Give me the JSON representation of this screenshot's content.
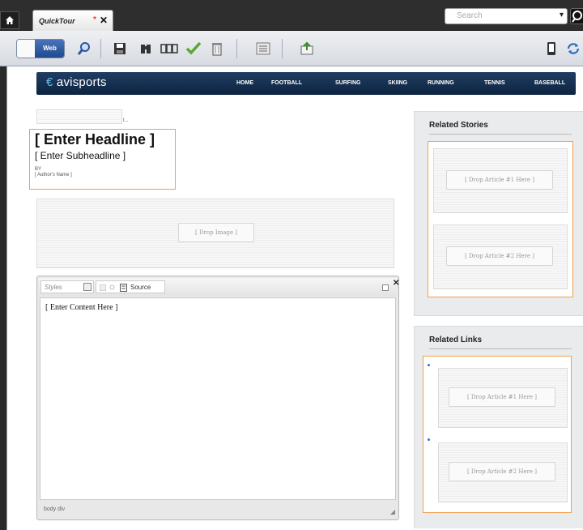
{
  "tabbar": {
    "tab_title": "QuickTour",
    "dirty_marker": "*",
    "close_glyph": "✕",
    "search_placeholder": "Search"
  },
  "toolbar": {
    "view_mode_label": "Web"
  },
  "nav": {
    "logo": "avisports",
    "items": [
      "HOME",
      "FOOTBALL",
      "SURFING",
      "SKIING",
      "RUNNING",
      "TENNIS",
      "BASEBALL"
    ]
  },
  "article": {
    "thin_placeholder_suffix": "t...",
    "headline": "[ Enter Headline ]",
    "subheadline": "[ Enter Subheadline ]",
    "by_label": "BY",
    "author": "[ Author's Name ]",
    "image_drop": "[ Drop Image ]"
  },
  "editor": {
    "styles_label": "Styles",
    "source_label": "Source",
    "content": "[ Enter Content Here ]",
    "status_path": "body  div",
    "close_glyph": "✕"
  },
  "related_stories": {
    "title": "Related Stories",
    "items": [
      "[ Drop Article #1 Here ]",
      "[ Drop Article #2 Here ]"
    ]
  },
  "related_links": {
    "title": "Related Links",
    "items": [
      "[ Drop Article #1 Here ]",
      "[ Drop Article #2 Here ]"
    ]
  },
  "icons": {
    "home": "home-icon",
    "search": "search-icon",
    "save": "save-icon",
    "binoculars": "binoculars-icon",
    "layout": "layout-icon",
    "approve": "checkmark-icon",
    "delete": "trash-icon",
    "list": "list-icon",
    "insert": "insert-icon",
    "mobile": "mobile-device-icon",
    "refresh": "refresh-icon"
  },
  "colors": {
    "nav_bg": "#132f4f",
    "highlight_border": "#f0a050",
    "view_toggle_on": "#2a569c"
  }
}
